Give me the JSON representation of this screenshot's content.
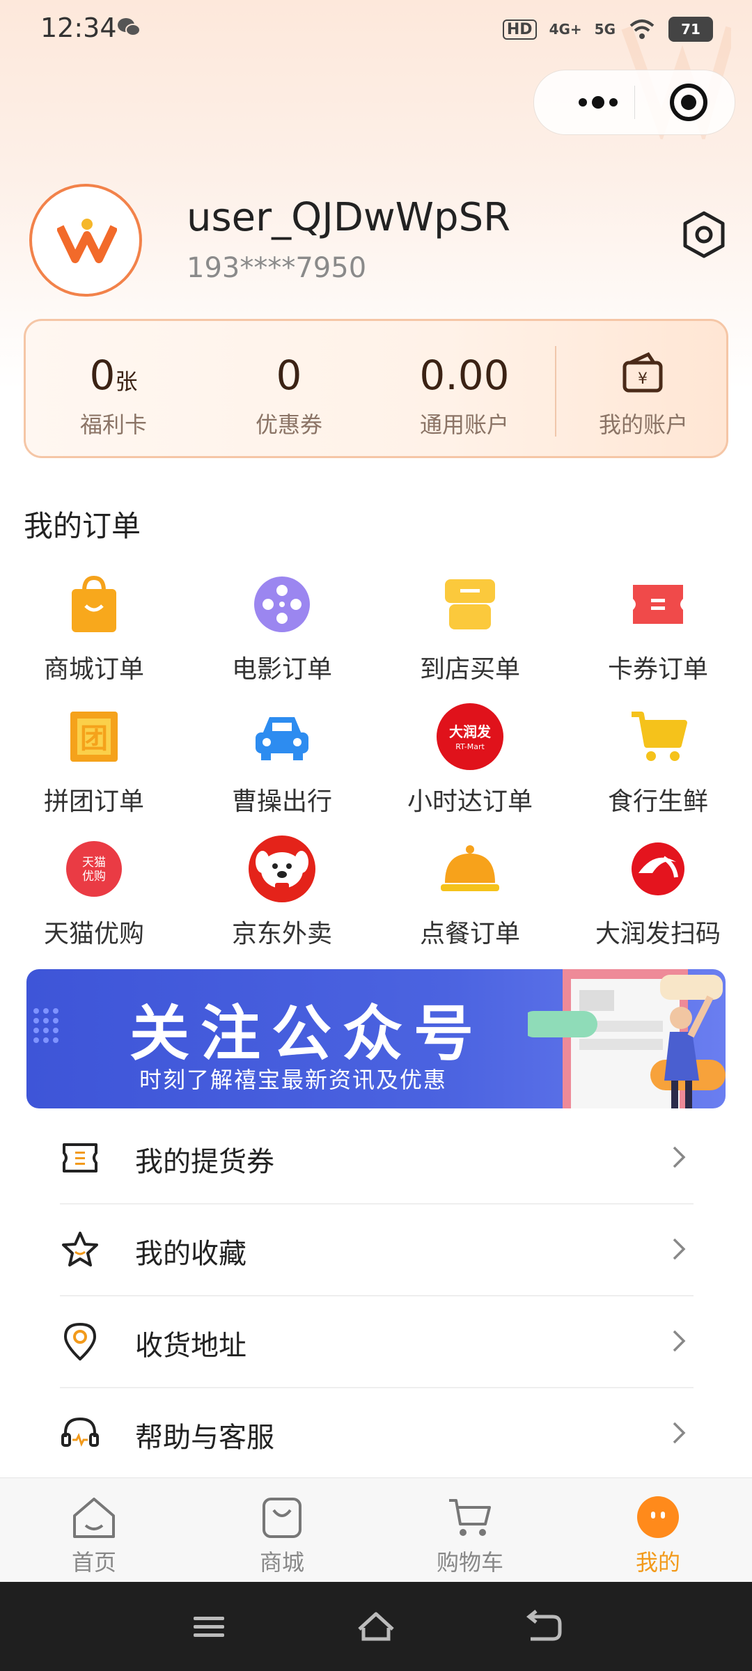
{
  "status_bar": {
    "time": "12:34",
    "hd": "HD",
    "net1": "4G+",
    "net2": "5G",
    "battery": "71"
  },
  "profile": {
    "username": "user_QJDwWpSR",
    "phone": "193****7950"
  },
  "account": {
    "items": [
      {
        "value": "0",
        "unit": "张",
        "label": "福利卡"
      },
      {
        "value": "0",
        "unit": "",
        "label": "优惠券"
      },
      {
        "value": "0.00",
        "unit": "",
        "label": "通用账户"
      }
    ],
    "my_account_label": "我的账户"
  },
  "orders": {
    "title": "我的订单",
    "items": [
      {
        "label": "商城订单",
        "icon": "shopping-bag-icon"
      },
      {
        "label": "电影订单",
        "icon": "film-reel-icon"
      },
      {
        "label": "到店买单",
        "icon": "store-icon"
      },
      {
        "label": "卡券订单",
        "icon": "ticket-icon"
      },
      {
        "label": "拼团订单",
        "icon": "group-buy-icon"
      },
      {
        "label": "曹操出行",
        "icon": "car-icon"
      },
      {
        "label": "小时达订单",
        "icon": "rt-mart-logo-icon"
      },
      {
        "label": "食行生鲜",
        "icon": "cart-icon"
      },
      {
        "label": "天猫优购",
        "icon": "tmall-logo-icon"
      },
      {
        "label": "京东外卖",
        "icon": "jd-dog-icon"
      },
      {
        "label": "点餐订单",
        "icon": "food-cloche-icon"
      },
      {
        "label": "大润发扫码",
        "icon": "rt-scan-icon"
      }
    ],
    "rt_logo_text": "大润发",
    "tmall_logo_text": "天猫优购"
  },
  "banner": {
    "title": "关注公众号",
    "subtitle": "时刻了解禧宝最新资讯及优惠"
  },
  "menu": [
    {
      "label": "我的提货券",
      "icon": "voucher-icon"
    },
    {
      "label": "我的收藏",
      "icon": "star-icon"
    },
    {
      "label": "收货地址",
      "icon": "location-pin-icon"
    },
    {
      "label": "帮助与客服",
      "icon": "headset-icon"
    }
  ],
  "tabbar": [
    {
      "label": "首页",
      "icon": "home-icon",
      "active": false
    },
    {
      "label": "商城",
      "icon": "bag-icon",
      "active": false
    },
    {
      "label": "购物车",
      "icon": "cart-icon",
      "active": false
    },
    {
      "label": "我的",
      "icon": "profile-face-icon",
      "active": true
    }
  ],
  "colors": {
    "accent": "#f29a1b",
    "brand_orange": "#f2824a",
    "banner_blue": "#4b63e0"
  }
}
